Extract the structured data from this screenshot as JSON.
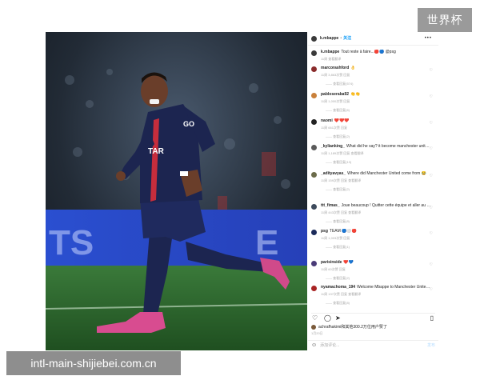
{
  "badge": "世界杯",
  "watermark": "intl-main-shijiebei.com.cn",
  "post": {
    "header": {
      "username": "k.mbappe",
      "dot": "•",
      "follow": "关注",
      "more": "•••"
    },
    "caption": {
      "username": "k.mbappe",
      "text": "Tout reste à faire...🔴🔵 @psg",
      "meta": "11周  查看翻译"
    },
    "comments": [
      {
        "username": "marcorashford",
        "text": "👌",
        "meta": "11周  3,863次赞  回复",
        "view": "—— 查看回复(574)",
        "avatar": "#8a2b2b"
      },
      {
        "username": "pabloseraba92",
        "text": "👏👏",
        "meta": "11周  1,000次赞  回复",
        "view": "—— 查看回复(6)",
        "avatar": "#c9803a"
      },
      {
        "username": "naomi",
        "text": "❤️❤️❤️",
        "meta": "11周  661次赞  回复",
        "view": "—— 查看回复(2)",
        "avatar": "#222222"
      },
      {
        "username": "_kylianking_",
        "text": "What did he say? it become manchester united in my translation😂",
        "meta": "11周  1,189次赞  回复  查看翻译",
        "view": "—— 查看回复(13)",
        "avatar": "#5a5a5a"
      },
      {
        "username": "_adityavyas_",
        "text": "Where did Manchester United come from 😂",
        "meta": "11周  159次赞  回复  查看翻译",
        "view": "—— 查看回复(2)",
        "avatar": "#6b6b4a"
      },
      {
        "username": "ttt_fimas_",
        "text": "Joue beaucoup ! Quitter cette équipe et aller au Real Madrid 💙",
        "meta": "11周  443次赞  回复  查看翻译",
        "view": "—— 查看回复(8)",
        "avatar": "#3d4a5c"
      },
      {
        "username": "psg",
        "text": "TEAM 🔵⚪🔴",
        "meta": "11周  1,003次赞  回复",
        "view": "—— 查看回复(1)",
        "avatar": "#1b2a5a"
      },
      {
        "username": "parisinside",
        "text": "❤️💙",
        "meta": "11周  60次赞  回复",
        "view": "—— 查看回复(2)",
        "avatar": "#4a3b78"
      },
      {
        "username": "nyamachoma_194",
        "text": "Welcome Mbappe to Manchester United😂 #hatwaago 😂😂😂",
        "meta": "11周  137次赞  回复  查看翻译",
        "view": "—— 查看回复(8)",
        "avatar": "#a82323"
      }
    ],
    "actions": {
      "like": "♡",
      "comment": "◯",
      "share": "➤",
      "save": "▯"
    },
    "likes": "achrafhakimi和其他300.2万位用户赞了",
    "date": "1月20日",
    "add_comment": {
      "emoji": "☺",
      "placeholder": "添加评论...",
      "post": "发布"
    }
  },
  "colors": {
    "accent": "#0095f6",
    "pitch": "#2f6b2f",
    "jersey": "#1c2550"
  }
}
